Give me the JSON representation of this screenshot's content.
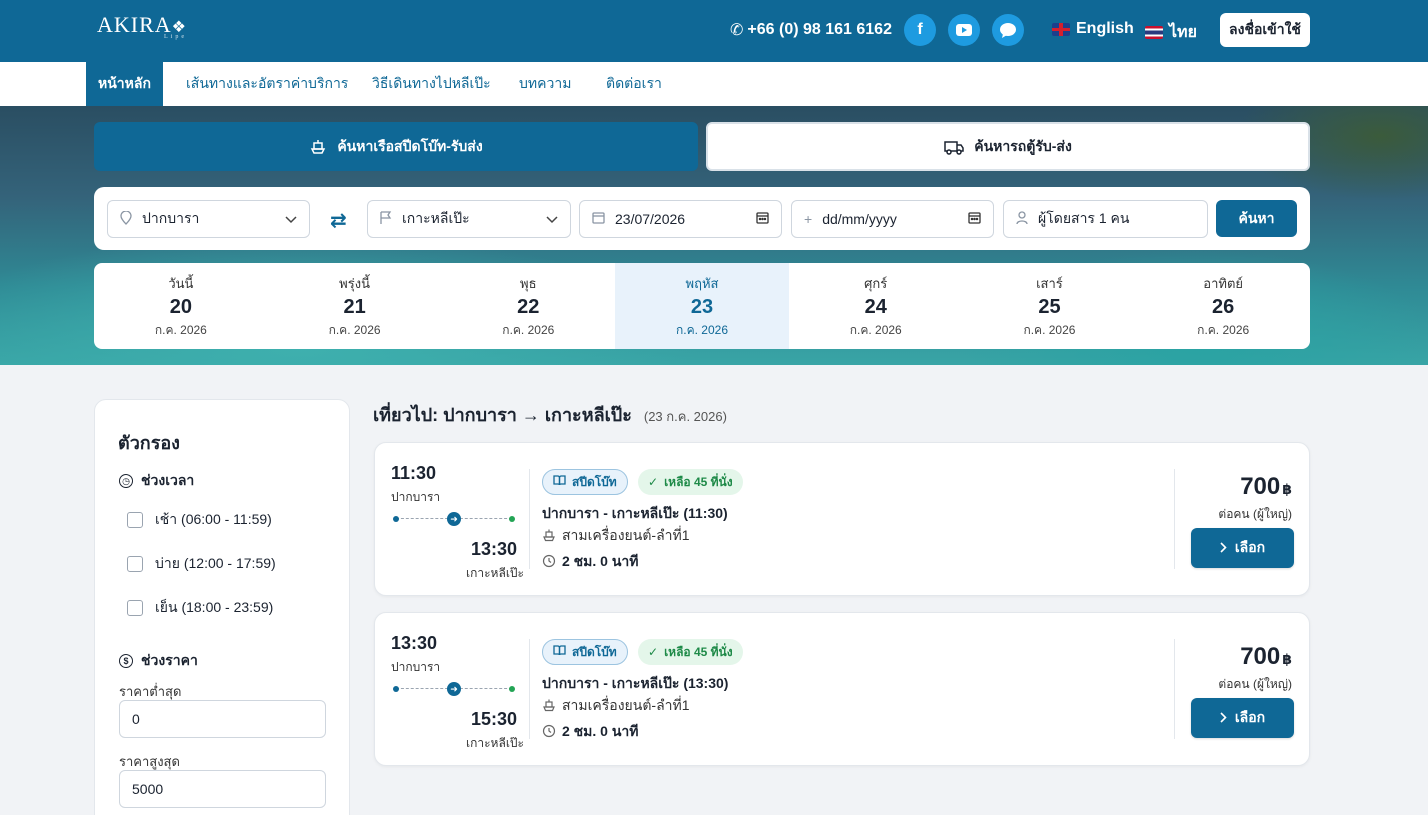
{
  "header": {
    "logo_text": "AKIRA",
    "logo_sub": "Lipe",
    "phone": "+66 (0) 98 161 6162",
    "lang_en": "English",
    "lang_th": "ไทย",
    "login": "ลงชื่อเข้าใช้"
  },
  "nav": {
    "items": [
      "หน้าหลัก",
      "เส้นทางและอัตราค่าบริการ",
      "วิธีเดินทางไปหลีเป๊ะ",
      "บทความ",
      "ติดต่อเรา"
    ]
  },
  "mode_tabs": {
    "boat": "ค้นหาเรือสปีดโบ๊ท-รับส่ง",
    "van": "ค้นหารถตู้รับ-ส่ง"
  },
  "search": {
    "origin": "ปากบารา",
    "destination": "เกาะหลีเป๊ะ",
    "depart_date": "23/07/2026",
    "return_placeholder": "dd/mm/yyyy",
    "passengers": "ผู้โดยสาร 1 คน",
    "button": "ค้นหา"
  },
  "dates": [
    {
      "weekday": "วันนี้",
      "day": "20",
      "month": "ก.ค. 2026"
    },
    {
      "weekday": "พรุ่งนี้",
      "day": "21",
      "month": "ก.ค. 2026"
    },
    {
      "weekday": "พุธ",
      "day": "22",
      "month": "ก.ค. 2026"
    },
    {
      "weekday": "พฤหัส",
      "day": "23",
      "month": "ก.ค. 2026"
    },
    {
      "weekday": "ศุกร์",
      "day": "24",
      "month": "ก.ค. 2026"
    },
    {
      "weekday": "เสาร์",
      "day": "25",
      "month": "ก.ค. 2026"
    },
    {
      "weekday": "อาทิตย์",
      "day": "26",
      "month": "ก.ค. 2026"
    }
  ],
  "filter": {
    "title": "ตัวกรอง",
    "time_heading": "ช่วงเวลา",
    "time_options": [
      "เช้า (06:00 - 11:59)",
      "บ่าย (12:00 - 17:59)",
      "เย็น (18:00 - 23:59)"
    ],
    "price_heading": "ช่วงราคา",
    "min_label": "ราคาต่ำสุด",
    "min_value": "0",
    "max_label": "ราคาสูงสุด",
    "max_value": "5000"
  },
  "results": {
    "title": "เที่ยวไป: ปากบารา → เกาะหลีเป๊ะ",
    "date": "(23 ก.ค. 2026)",
    "trips": [
      {
        "depart_time": "11:30",
        "depart_place": "ปากบารา",
        "arrive_time": "13:30",
        "arrive_place": "เกาะหลีเป๊ะ",
        "type": "สปีดโบ๊ท",
        "seats": "เหลือ 45 ที่นั่ง",
        "name": "ปากบารา - เกาะหลีเป๊ะ (11:30)",
        "boat": "สามเครื่องยนต์-ลำที่1",
        "duration": "2 ชม. 0 นาที",
        "price": "700",
        "currency": "฿",
        "per": "ต่อคน (ผู้ใหญ่)",
        "select": "เลือก"
      },
      {
        "depart_time": "13:30",
        "depart_place": "ปากบารา",
        "arrive_time": "15:30",
        "arrive_place": "เกาะหลีเป๊ะ",
        "type": "สปีดโบ๊ท",
        "seats": "เหลือ 45 ที่นั่ง",
        "name": "ปากบารา - เกาะหลีเป๊ะ (13:30)",
        "boat": "สามเครื่องยนต์-ลำที่1",
        "duration": "2 ชม. 0 นาที",
        "price": "700",
        "currency": "฿",
        "per": "ต่อคน (ผู้ใหญ่)",
        "select": "เลือก"
      }
    ]
  }
}
